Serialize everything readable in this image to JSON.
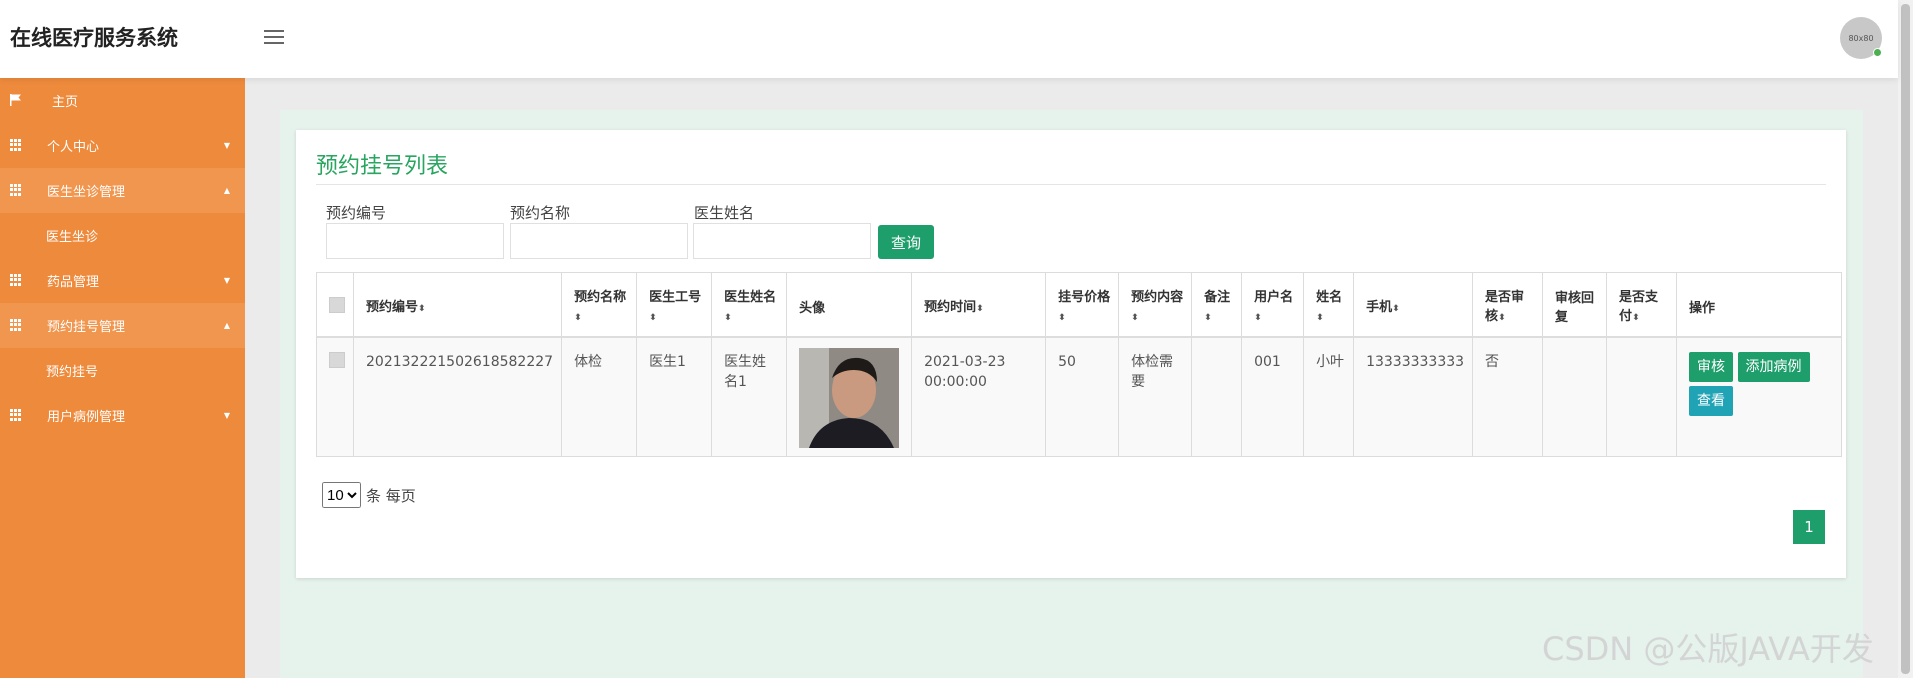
{
  "app": {
    "title": "在线医疗服务系统",
    "avatar_text": "80x80"
  },
  "sidebar": {
    "items": [
      {
        "label": "主页",
        "icon": "flag-icon"
      },
      {
        "label": "个人中心",
        "icon": "grid-icon",
        "caret": "▼"
      },
      {
        "label": "医生坐诊管理",
        "icon": "grid-icon",
        "caret": "▲",
        "sub": "医生坐诊"
      },
      {
        "label": "药品管理",
        "icon": "grid-icon",
        "caret": "▼"
      },
      {
        "label": "预约挂号管理",
        "icon": "grid-icon",
        "caret": "▲",
        "sub": "预约挂号"
      },
      {
        "label": "用户病例管理",
        "icon": "grid-icon",
        "caret": "▼"
      }
    ]
  },
  "page": {
    "title": "预约挂号列表",
    "search": {
      "fields": [
        {
          "label": "预约编号",
          "value": ""
        },
        {
          "label": "预约名称",
          "value": ""
        },
        {
          "label": "医生姓名",
          "value": ""
        }
      ],
      "query_label": "查询"
    },
    "table": {
      "headers": [
        "预约编号",
        "预约名称",
        "医生工号",
        "医生姓名",
        "头像",
        "预约时间",
        "挂号价格",
        "预约内容",
        "备注",
        "用户名",
        "姓名",
        "手机",
        "是否审核",
        "审核回复",
        "是否支付",
        "操作"
      ],
      "rows": [
        {
          "id": "202132221502618582227",
          "name": "体检",
          "doctor_no": "医生1",
          "doctor_name": "医生姓名1",
          "time": "2021-03-23 00:00:00",
          "price": "50",
          "content": "体检需要",
          "remark": "",
          "username": "001",
          "realname": "小叶",
          "phone": "13333333333",
          "audited": "否",
          "reply": "",
          "paid": "",
          "actions": {
            "audit": "审核",
            "add_case": "添加病例",
            "view": "查看"
          }
        }
      ]
    },
    "pagination": {
      "page_size": "10",
      "page_size_suffix": "条 每页",
      "current_page": "1"
    }
  },
  "watermark": "CSDN @公版JAVA开发",
  "colors": {
    "sidebar": "#ee8a3c",
    "accent": "#1e9e6a",
    "title": "#28a55f",
    "teal": "#21a3b6"
  }
}
